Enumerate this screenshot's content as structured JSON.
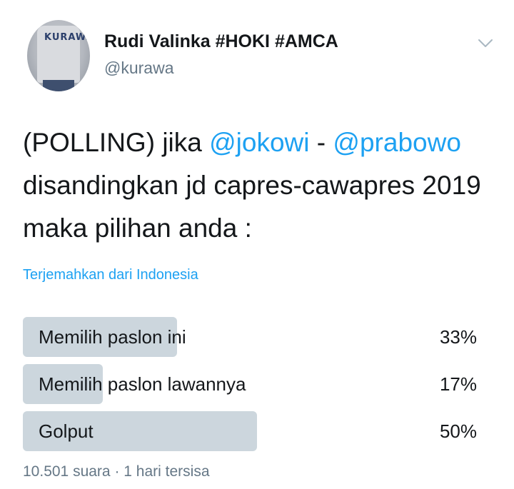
{
  "author": {
    "display_name": "Rudi Valinka #HOKI #AMCA",
    "handle": "@kurawa",
    "avatar_text": "KURAWA"
  },
  "icons": {
    "menu": "chevron-down-icon"
  },
  "tweet": {
    "text_prefix": "(POLLING) jika ",
    "mention_1": "@jokowi",
    "separator": " - ",
    "mention_2": "@prabowo",
    "text_suffix": " disandingkan jd capres-cawapres 2019 maka pilihan anda :",
    "translate_link": "Terjemahkan dari Indonesia"
  },
  "poll": {
    "options": [
      {
        "label": "Memilih paslon ini",
        "percent_text": "33%",
        "percent": 33
      },
      {
        "label": "Memilih paslon lawannya",
        "percent_text": "17%",
        "percent": 17
      },
      {
        "label": "Golput",
        "percent_text": "50%",
        "percent": 50
      }
    ],
    "votes": "10.501 suara",
    "dot": " · ",
    "time_left": "1 hari tersisa"
  },
  "colors": {
    "link": "#1da1f2",
    "bar": "#ccd6dd",
    "text": "#14171a",
    "muted": "#657786"
  }
}
